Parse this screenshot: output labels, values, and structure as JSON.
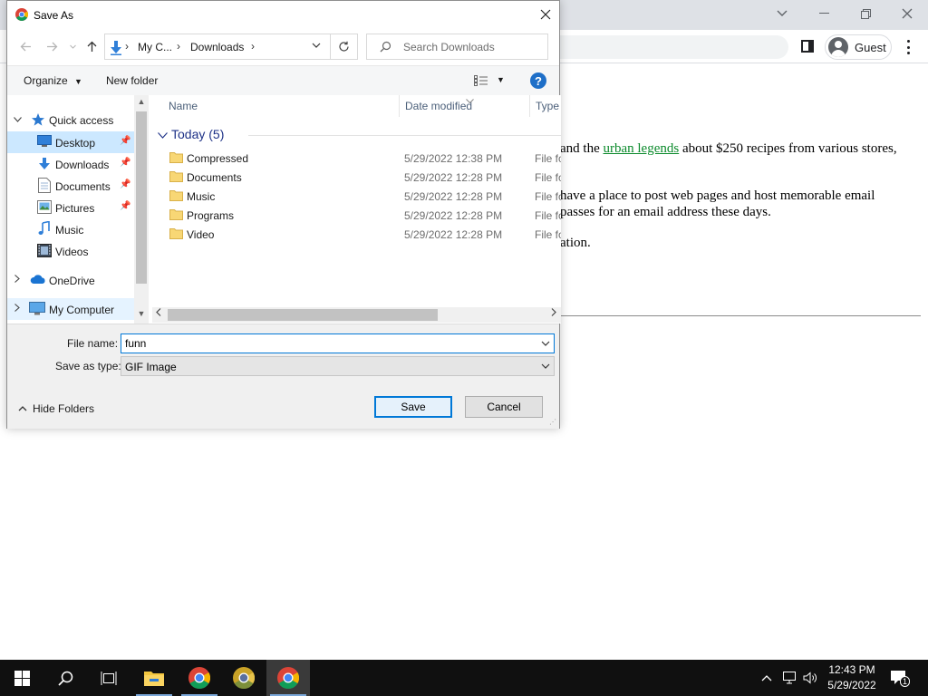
{
  "dialog": {
    "title": "Save As",
    "breadcrumbs": [
      "My C...",
      "Downloads"
    ],
    "search_placeholder": "Search Downloads",
    "toolbar": {
      "organize": "Organize",
      "new_folder": "New folder",
      "help": "?"
    },
    "nav": {
      "items": [
        {
          "label": "Quick access"
        },
        {
          "label": "Desktop"
        },
        {
          "label": "Downloads"
        },
        {
          "label": "Documents"
        },
        {
          "label": "Pictures"
        },
        {
          "label": "Music"
        },
        {
          "label": "Videos"
        },
        {
          "label": "OneDrive"
        },
        {
          "label": "My Computer"
        }
      ]
    },
    "columns": {
      "name": "Name",
      "date_modified": "Date modified",
      "type": "Type"
    },
    "group_label": "Today (5)",
    "files": [
      {
        "name": "Compressed",
        "date": "5/29/2022 12:38 PM",
        "type": "File fo"
      },
      {
        "name": "Documents",
        "date": "5/29/2022 12:28 PM",
        "type": "File fo"
      },
      {
        "name": "Music",
        "date": "5/29/2022 12:28 PM",
        "type": "File fo"
      },
      {
        "name": "Programs",
        "date": "5/29/2022 12:28 PM",
        "type": "File fo"
      },
      {
        "name": "Video",
        "date": "5/29/2022 12:28 PM",
        "type": "File fo"
      }
    ],
    "file_name_label": "File name:",
    "file_name_value": "funn",
    "save_type_label": "Save as type:",
    "save_type_value": "GIF Image",
    "hide_folders": "Hide Folders",
    "save_button": "Save",
    "cancel_button": "Cancel"
  },
  "browser": {
    "profile": "Guest",
    "page": {
      "line1_pre": "and the ",
      "line1_link": "urban legends",
      "line1_post": " about $250 recipes from various stores,",
      "line2": "have a place to post web pages and host memorable email",
      "line3": "passes for an email address these days.",
      "line4": "ation."
    }
  },
  "taskbar": {
    "time": "12:43 PM",
    "date": "5/29/2022",
    "notification_count": "1"
  },
  "colors": {
    "accent": "#0078d7",
    "link": "#0b8a2b",
    "nav_selected": "#cce8ff",
    "taskbar": "#101010"
  }
}
